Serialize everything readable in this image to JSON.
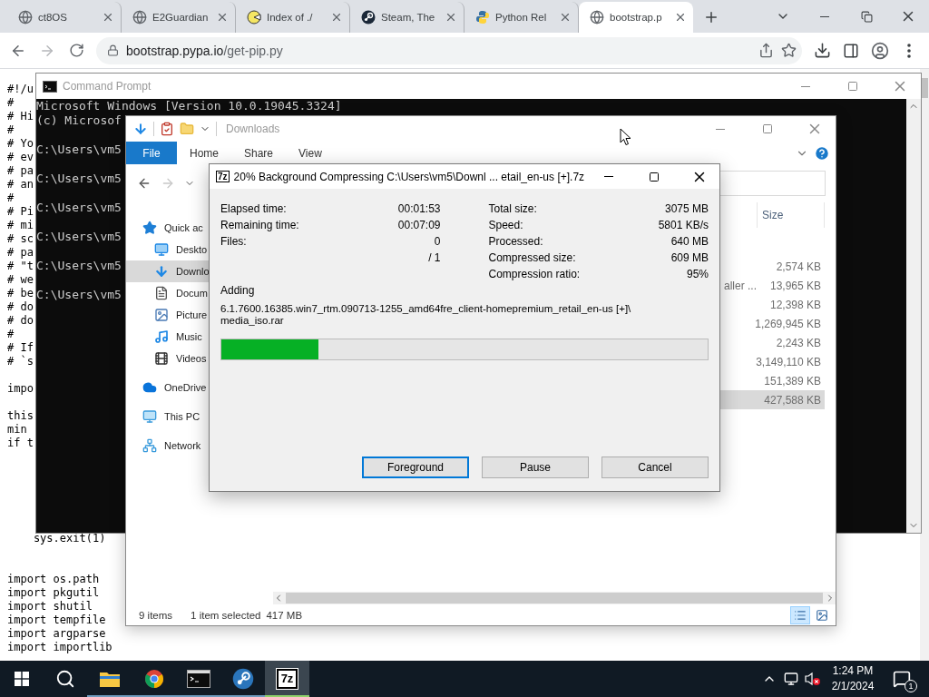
{
  "browser": {
    "tabs": [
      {
        "label": "ct8OS",
        "kind": "globe",
        "selected": false
      },
      {
        "label": "E2Guardian",
        "kind": "globe",
        "selected": false
      },
      {
        "label": "Index of ./",
        "kind": "round",
        "selected": false
      },
      {
        "label": "Steam, The",
        "kind": "steam",
        "selected": false
      },
      {
        "label": "Python Rel",
        "kind": "python",
        "selected": false
      },
      {
        "label": "bootstrap.p",
        "kind": "globe",
        "selected": true
      }
    ],
    "url": {
      "host": "bootstrap.pypa.io",
      "path": "/get-pip.py"
    },
    "page_blocks": [
      [
        "#!/u",
        "#",
        "# Hi",
        "#",
        "# Yo",
        "# ev",
        "# pa",
        "# an",
        "#",
        "# Pi",
        "# mi",
        "# sc",
        "# pa",
        "# \"t",
        "# we",
        "# be",
        "# do",
        "# do",
        "#",
        "# If",
        "# `s"
      ],
      [
        "impo"
      ],
      [
        "this",
        "min",
        "if t"
      ],
      [
        "    sys.exit(1)"
      ],
      [
        "import os.path",
        "import pkgutil",
        "import shutil",
        "import tempfile",
        "import argparse",
        "import importlib"
      ]
    ]
  },
  "command_prompt": {
    "title": "Command Prompt",
    "blocks": [
      [
        "Microsoft Windows [Version 10.0.19045.3324]",
        "(c) Microsof"
      ],
      [
        "C:\\Users\\vm5"
      ],
      [
        "C:\\Users\\vm5"
      ],
      [
        "C:\\Users\\vm5"
      ],
      [
        "C:\\Users\\vm5"
      ],
      [
        "C:\\Users\\vm5"
      ],
      [
        "C:\\Users\\vm5"
      ]
    ]
  },
  "explorer": {
    "title": "Downloads",
    "ribbon": [
      {
        "label": "File",
        "kind": "menu"
      },
      {
        "label": "Home",
        "kind": "tab"
      },
      {
        "label": "Share",
        "kind": "tab"
      },
      {
        "label": "View",
        "kind": "tab"
      }
    ],
    "nav": [
      {
        "label": "Quick ac",
        "kind": "star",
        "selected": false,
        "children": [
          {
            "label": "Deskto",
            "kind": "desktop",
            "selected": false
          },
          {
            "label": "Downlo",
            "kind": "download",
            "selected": true
          },
          {
            "label": "Docum",
            "kind": "document",
            "selected": false
          },
          {
            "label": "Picture",
            "kind": "pictures",
            "selected": false
          },
          {
            "label": "Music",
            "kind": "music",
            "selected": false
          },
          {
            "label": "Videos",
            "kind": "videos",
            "selected": false
          }
        ]
      },
      {
        "label": "OneDrive",
        "kind": "cloud",
        "selected": false
      },
      {
        "label": "This PC",
        "kind": "pc",
        "selected": false
      },
      {
        "label": "Network",
        "kind": "network",
        "selected": false
      }
    ],
    "columns": [
      {
        "label": "Size"
      }
    ],
    "rows": [
      {
        "size": "2,574 KB",
        "selected": false
      },
      {
        "column_1": "aller ...",
        "size": "13,965 KB",
        "selected": false
      },
      {
        "size": "12,398 KB",
        "selected": false
      },
      {
        "size": "1,269,945 KB",
        "selected": false
      },
      {
        "size": "2,243 KB",
        "selected": false
      },
      {
        "size": "3,149,110 KB",
        "selected": false
      },
      {
        "size": "151,389 KB",
        "selected": false
      },
      {
        "size": "427,588 KB",
        "selected": true
      }
    ],
    "status": {
      "items": "9 items",
      "selection": "1 item selected",
      "selection_size": "417 MB"
    },
    "views": [
      {
        "kind": "details",
        "selected": true
      },
      {
        "kind": "large-icons",
        "selected": false
      }
    ]
  },
  "dialog": {
    "logo": "7z",
    "title": "20% Background Compressing C:\\Users\\vm5\\Downl ... etail_en-us [+].7z",
    "left_stats": [
      {
        "label": "Elapsed time:",
        "value": "00:01:53"
      },
      {
        "label": "Remaining time:",
        "value": "00:07:09"
      },
      {
        "label": "Files:",
        "value": "0"
      },
      {
        "value": "/ 1"
      }
    ],
    "right_stats": [
      {
        "label": "Total size:",
        "value": "3075 MB"
      },
      {
        "label": "Speed:",
        "value": "5801 KB/s"
      },
      {
        "label": "Processed:",
        "value": "640 MB"
      },
      {
        "label": "Compressed size:",
        "value": "609 MB"
      },
      {
        "label": "Compression ratio:",
        "value": "95%"
      }
    ],
    "action": "Adding",
    "file_lines": [
      "6.1.7600.16385.win7_rtm.090713-1255_amd64fre_client-homepremium_retail_en-us [+]\\",
      "media_iso.rar"
    ],
    "progress": {
      "level": 0.2
    },
    "buttons": [
      {
        "label": "Foreground",
        "focused": true
      },
      {
        "label": "Pause",
        "focused": false
      },
      {
        "label": "Cancel",
        "focused": false
      }
    ]
  },
  "taskbar": {
    "apps": [
      {
        "kind": "explorer",
        "selected": false
      },
      {
        "kind": "chrome",
        "selected": false
      },
      {
        "kind": "terminal",
        "selected": false
      },
      {
        "kind": "steam",
        "selected": false
      },
      {
        "kind": "sevenzip",
        "label": "7z",
        "selected": true
      }
    ],
    "time": "1:24 PM",
    "date": "2/1/2024",
    "notifications": "1"
  }
}
